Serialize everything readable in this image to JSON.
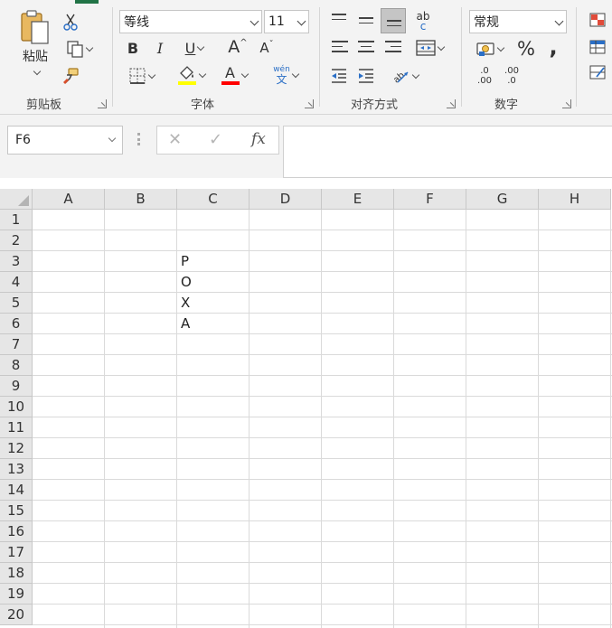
{
  "ribbon": {
    "clipboard": {
      "paste_label": "粘贴",
      "group_label": "剪贴板",
      "icons": [
        "paste-icon",
        "cut-icon",
        "copy-icon",
        "format-painter-icon"
      ]
    },
    "font": {
      "font_name": "等线",
      "font_size": "11",
      "bold": "B",
      "italic": "I",
      "underline": "U",
      "grow": "A",
      "shrink": "A",
      "font_color": "A",
      "phonetic_top": "wén",
      "phonetic_bottom": "文",
      "group_label": "字体",
      "fill_color": "#ffff00",
      "text_color": "#ff0000"
    },
    "alignment": {
      "group_label": "对齐方式",
      "wrap_top": "ab",
      "wrap_bottom": "c"
    },
    "number": {
      "format": "常规",
      "percent": "%",
      "comma": ",",
      "inc_decimal_top": ".0",
      "inc_decimal_bottom": ".00",
      "dec_decimal_top": ".00",
      "dec_decimal_bottom": ".0",
      "group_label": "数字"
    }
  },
  "formula_bar": {
    "name_box": "F6",
    "cancel_symbol": "✕",
    "enter_symbol": "✓",
    "fx_label": "fx",
    "content": ""
  },
  "sheet": {
    "columns": [
      "A",
      "B",
      "C",
      "D",
      "E",
      "F",
      "G",
      "H"
    ],
    "rows": [
      "1",
      "2",
      "3",
      "4",
      "5",
      "6",
      "7",
      "8",
      "9",
      "10",
      "11",
      "12",
      "13",
      "14",
      "15",
      "16",
      "17",
      "18",
      "19",
      "20"
    ],
    "cells": {
      "C3": "P",
      "C4": "O",
      "C5": "X",
      "C6": "A"
    }
  }
}
